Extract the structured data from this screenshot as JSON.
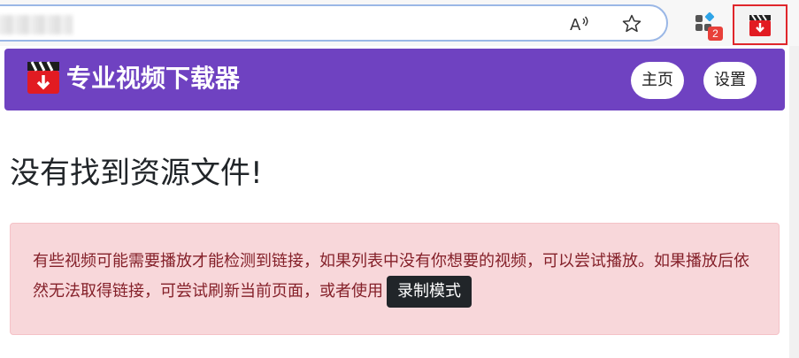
{
  "browser": {
    "address_text": "",
    "read_aloud_icon": "read-aloud-icon",
    "favorite_icon": "star-icon",
    "extensions_icon": "extensions-icon",
    "extensions_badge": "2",
    "active_extension_icon": "clapperboard-download-icon"
  },
  "navbar": {
    "brand_text": "专业视频下载器",
    "home_label": "主页",
    "settings_label": "设置"
  },
  "main": {
    "heading": "没有找到资源文件!",
    "alert_text": "有些视频可能需要播放才能检测到链接，如果列表中没有你想要的视频，可以尝试播放。如果播放后依然无法取得链接，可尝试刷新当前页面，或者使用",
    "record_mode_label": "录制模式"
  },
  "colors": {
    "navbar_bg": "#6f42c1",
    "alert_bg": "#f8d7da",
    "alert_text": "#842029",
    "record_button_bg": "#212529",
    "active_extension_border": "#e0262b"
  }
}
